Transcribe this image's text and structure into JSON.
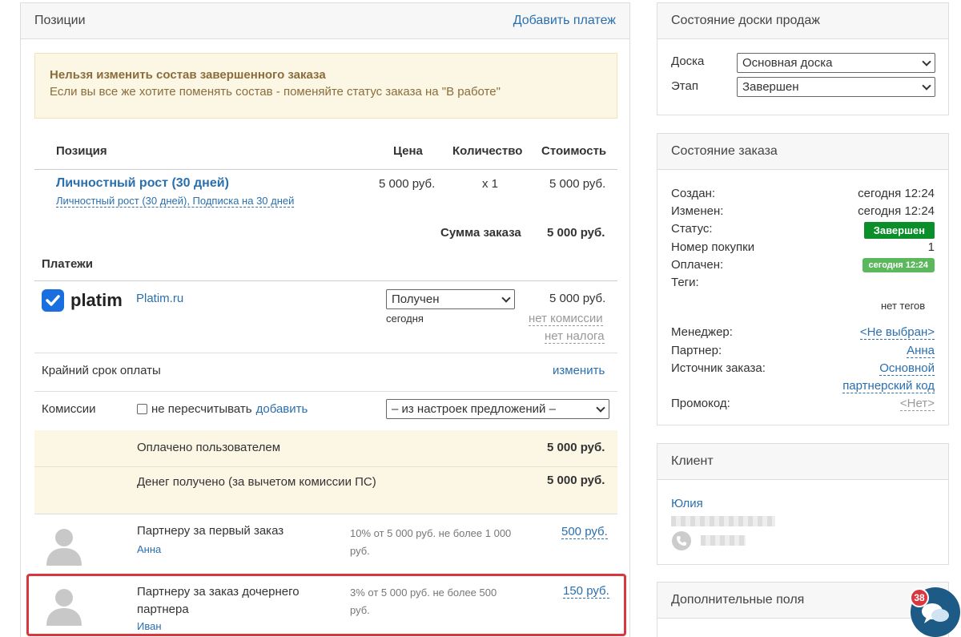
{
  "positions_panel": {
    "title": "Позиции",
    "add_payment": "Добавить платеж",
    "warning_title": "Нельзя изменить состав завершенного заказа",
    "warning_text": "Если вы все же хотите поменять состав - поменяйте статус заказа на \"В работе\"",
    "columns": {
      "position": "Позиция",
      "price": "Цена",
      "quantity": "Количество",
      "cost": "Стоимость"
    },
    "item": {
      "name": "Личностный рост (30 дней)",
      "sub": "Личностный рост (30 дней), Подписка на 30 дней",
      "price": "5 000 руб.",
      "quantity": "x 1",
      "cost": "5 000 руб."
    },
    "total_label": "Сумма заказа",
    "total_value": "5 000 руб.",
    "payments_label": "Платежи",
    "payment": {
      "logo_text": "platim",
      "name": "Platim.ru",
      "status": "Получен",
      "date": "сегодня",
      "amount": "5 000 руб.",
      "no_commission": "нет комиссии",
      "no_tax": "нет налога"
    },
    "deadline_label": "Крайний срок оплаты",
    "deadline_action": "изменить",
    "commissions_label": "Комиссии",
    "no_recalc": "не пересчитывать",
    "add_link": "добавить",
    "commission_select": "– из настроек предложений –",
    "paid_by_user_label": "Оплачено пользователем",
    "paid_by_user_value": "5 000 руб.",
    "received_label": "Денег получено (за вычетом комиссии ПС)",
    "received_value": "5 000 руб.",
    "partners": [
      {
        "title": "Партнеру за первый заказ",
        "name": "Анна",
        "rule": "10% от 5 000 руб. не более 1 000 руб.",
        "amount": "500 руб."
      },
      {
        "title": "Партнеру за заказ дочернего партнера",
        "name": "Иван",
        "rule": "3% от 5 000 руб. не более 500 руб.",
        "amount": "150 руб."
      }
    ]
  },
  "board_panel": {
    "title": "Состояние доски продаж",
    "board_label": "Доска",
    "board_value": "Основная доска",
    "stage_label": "Этап",
    "stage_value": "Завершен"
  },
  "order_panel": {
    "title": "Состояние заказа",
    "created_label": "Создан:",
    "created_value": "сегодня 12:24",
    "modified_label": "Изменен:",
    "modified_value": "сегодня 12:24",
    "status_label": "Статус:",
    "status_value": "Завершен",
    "purchase_label": "Номер покупки",
    "purchase_value": "1",
    "paid_label": "Оплачен:",
    "paid_value": "сегодня 12:24",
    "tags_label": "Теги:",
    "tags_value": "нет тегов",
    "manager_label": "Менеджер:",
    "manager_value": "<Не выбран>",
    "partner_label": "Партнер:",
    "partner_value": "Анна",
    "source_label": "Источник заказа:",
    "source_value_1": "Основной",
    "source_value_2": "партнерский код",
    "promo_label": "Промокод:",
    "promo_value": "<Нет>"
  },
  "client_panel": {
    "title": "Клиент",
    "name": "Юлия"
  },
  "extra_panel": {
    "title": "Дополнительные поля"
  },
  "chat": {
    "badge": "38"
  },
  "colors": {
    "accent": "#2a6fae",
    "status_green": "#0a8f2a",
    "warning_bg": "#fcf6e4",
    "highlight": "#d9363e"
  }
}
